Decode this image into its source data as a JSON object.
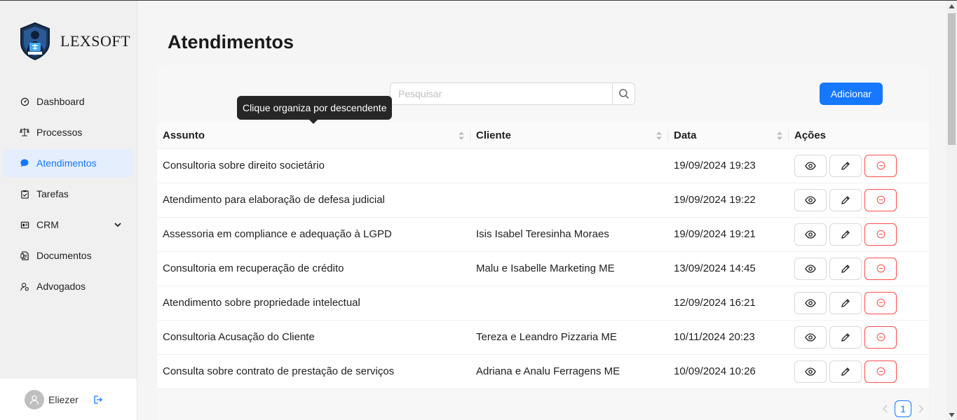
{
  "brand": {
    "name": "LEXSOFT"
  },
  "sidebar": {
    "items": [
      {
        "label": "Dashboard",
        "icon": "dashboard-icon"
      },
      {
        "label": "Processos",
        "icon": "scale-icon"
      },
      {
        "label": "Atendimentos",
        "icon": "chat-icon",
        "active": true
      },
      {
        "label": "Tarefas",
        "icon": "clipboard-icon"
      },
      {
        "label": "CRM",
        "icon": "crm-icon",
        "has_submenu": true
      },
      {
        "label": "Documentos",
        "icon": "document-icon"
      },
      {
        "label": "Advogados",
        "icon": "lawyer-icon"
      }
    ],
    "user": {
      "name": "Eliezer"
    }
  },
  "page": {
    "title": "Atendimentos"
  },
  "search": {
    "placeholder": "Pesquisar",
    "value": ""
  },
  "toolbar": {
    "add_label": "Adicionar"
  },
  "tooltip": {
    "text": "Clique organiza por descendente"
  },
  "table": {
    "columns": [
      "Assunto",
      "Cliente",
      "Data",
      "Ações"
    ],
    "rows": [
      {
        "assunto": "Consultoria sobre direito societário",
        "cliente": "",
        "data": "19/09/2024 19:23"
      },
      {
        "assunto": "Atendimento para elaboração de defesa judicial",
        "cliente": "",
        "data": "19/09/2024 19:22"
      },
      {
        "assunto": "Assessoria em compliance e adequação à LGPD",
        "cliente": "Isis Isabel Teresinha Moraes",
        "data": "19/09/2024 19:21"
      },
      {
        "assunto": "Consultoria em recuperação de crédito",
        "cliente": "Malu e Isabelle Marketing ME",
        "data": "13/09/2024 14:45"
      },
      {
        "assunto": "Atendimento sobre propriedade intelectual",
        "cliente": "",
        "data": "12/09/2024 16:21"
      },
      {
        "assunto": "Consultoria Acusação do Cliente",
        "cliente": "Tereza e Leandro Pizzaria ME",
        "data": "10/11/2024 20:23"
      },
      {
        "assunto": "Consulta sobre contrato de prestação de serviços",
        "cliente": "Adriana e Analu Ferragens ME",
        "data": "10/09/2024 10:26"
      }
    ]
  },
  "pagination": {
    "current": "1"
  },
  "colors": {
    "primary": "#1677ff",
    "danger": "#ff4d4f",
    "active_bg": "#e4eefc"
  }
}
